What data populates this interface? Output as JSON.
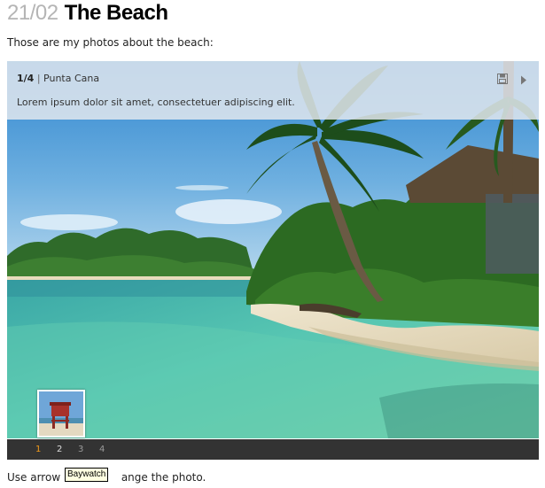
{
  "post": {
    "date": "21/02",
    "title": "The Beach",
    "intro": "Those are my photos about the beach:",
    "footer_prefix": "Use arrow",
    "footer_suffix": "ange the photo."
  },
  "slideshow": {
    "counter": "1/4",
    "separator": "|",
    "location": "Punta Cana",
    "description": "Lorem ipsum dolor sit amet, consectetuer adipiscing elit.",
    "icons": {
      "save": "save-icon",
      "next": "next-arrow-icon"
    },
    "pages": [
      "1",
      "2",
      "3",
      "4"
    ],
    "active_page": "1",
    "colors": {
      "active_page": "#f29a1a",
      "pager_background": "#333333"
    }
  },
  "tooltip": {
    "text": "Baywatch"
  }
}
